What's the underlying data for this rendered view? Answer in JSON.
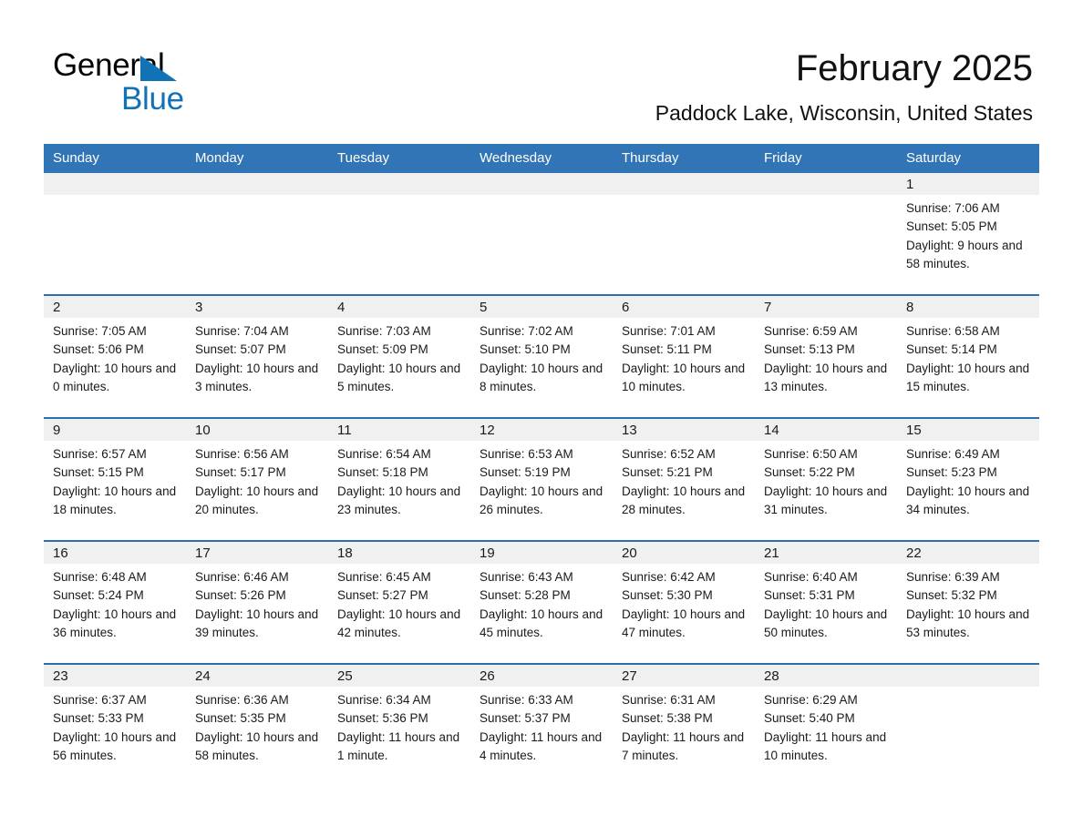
{
  "brand": {
    "name_part1": "General",
    "name_part2": "Blue",
    "triangle_color": "#1272b8"
  },
  "header": {
    "title": "February 2025",
    "subtitle": "Paddock Lake, Wisconsin, United States"
  },
  "colors": {
    "header_blue": "#3275b6",
    "row_rule_blue": "#2f6fae",
    "daynum_band": "#f0f0f0",
    "text": "#1a1a1a"
  },
  "weekday_headers": [
    "Sunday",
    "Monday",
    "Tuesday",
    "Wednesday",
    "Thursday",
    "Friday",
    "Saturday"
  ],
  "labels": {
    "sunrise_prefix": "Sunrise:",
    "sunset_prefix": "Sunset:",
    "daylight_prefix": "Daylight:"
  },
  "weeks": [
    [
      {
        "day": "",
        "sunrise": "",
        "sunset": "",
        "daylight": ""
      },
      {
        "day": "",
        "sunrise": "",
        "sunset": "",
        "daylight": ""
      },
      {
        "day": "",
        "sunrise": "",
        "sunset": "",
        "daylight": ""
      },
      {
        "day": "",
        "sunrise": "",
        "sunset": "",
        "daylight": ""
      },
      {
        "day": "",
        "sunrise": "",
        "sunset": "",
        "daylight": ""
      },
      {
        "day": "",
        "sunrise": "",
        "sunset": "",
        "daylight": ""
      },
      {
        "day": "1",
        "sunrise": "Sunrise: 7:06 AM",
        "sunset": "Sunset: 5:05 PM",
        "daylight": "Daylight: 9 hours and 58 minutes."
      }
    ],
    [
      {
        "day": "2",
        "sunrise": "Sunrise: 7:05 AM",
        "sunset": "Sunset: 5:06 PM",
        "daylight": "Daylight: 10 hours and 0 minutes."
      },
      {
        "day": "3",
        "sunrise": "Sunrise: 7:04 AM",
        "sunset": "Sunset: 5:07 PM",
        "daylight": "Daylight: 10 hours and 3 minutes."
      },
      {
        "day": "4",
        "sunrise": "Sunrise: 7:03 AM",
        "sunset": "Sunset: 5:09 PM",
        "daylight": "Daylight: 10 hours and 5 minutes."
      },
      {
        "day": "5",
        "sunrise": "Sunrise: 7:02 AM",
        "sunset": "Sunset: 5:10 PM",
        "daylight": "Daylight: 10 hours and 8 minutes."
      },
      {
        "day": "6",
        "sunrise": "Sunrise: 7:01 AM",
        "sunset": "Sunset: 5:11 PM",
        "daylight": "Daylight: 10 hours and 10 minutes."
      },
      {
        "day": "7",
        "sunrise": "Sunrise: 6:59 AM",
        "sunset": "Sunset: 5:13 PM",
        "daylight": "Daylight: 10 hours and 13 minutes."
      },
      {
        "day": "8",
        "sunrise": "Sunrise: 6:58 AM",
        "sunset": "Sunset: 5:14 PM",
        "daylight": "Daylight: 10 hours and 15 minutes."
      }
    ],
    [
      {
        "day": "9",
        "sunrise": "Sunrise: 6:57 AM",
        "sunset": "Sunset: 5:15 PM",
        "daylight": "Daylight: 10 hours and 18 minutes."
      },
      {
        "day": "10",
        "sunrise": "Sunrise: 6:56 AM",
        "sunset": "Sunset: 5:17 PM",
        "daylight": "Daylight: 10 hours and 20 minutes."
      },
      {
        "day": "11",
        "sunrise": "Sunrise: 6:54 AM",
        "sunset": "Sunset: 5:18 PM",
        "daylight": "Daylight: 10 hours and 23 minutes."
      },
      {
        "day": "12",
        "sunrise": "Sunrise: 6:53 AM",
        "sunset": "Sunset: 5:19 PM",
        "daylight": "Daylight: 10 hours and 26 minutes."
      },
      {
        "day": "13",
        "sunrise": "Sunrise: 6:52 AM",
        "sunset": "Sunset: 5:21 PM",
        "daylight": "Daylight: 10 hours and 28 minutes."
      },
      {
        "day": "14",
        "sunrise": "Sunrise: 6:50 AM",
        "sunset": "Sunset: 5:22 PM",
        "daylight": "Daylight: 10 hours and 31 minutes."
      },
      {
        "day": "15",
        "sunrise": "Sunrise: 6:49 AM",
        "sunset": "Sunset: 5:23 PM",
        "daylight": "Daylight: 10 hours and 34 minutes."
      }
    ],
    [
      {
        "day": "16",
        "sunrise": "Sunrise: 6:48 AM",
        "sunset": "Sunset: 5:24 PM",
        "daylight": "Daylight: 10 hours and 36 minutes."
      },
      {
        "day": "17",
        "sunrise": "Sunrise: 6:46 AM",
        "sunset": "Sunset: 5:26 PM",
        "daylight": "Daylight: 10 hours and 39 minutes."
      },
      {
        "day": "18",
        "sunrise": "Sunrise: 6:45 AM",
        "sunset": "Sunset: 5:27 PM",
        "daylight": "Daylight: 10 hours and 42 minutes."
      },
      {
        "day": "19",
        "sunrise": "Sunrise: 6:43 AM",
        "sunset": "Sunset: 5:28 PM",
        "daylight": "Daylight: 10 hours and 45 minutes."
      },
      {
        "day": "20",
        "sunrise": "Sunrise: 6:42 AM",
        "sunset": "Sunset: 5:30 PM",
        "daylight": "Daylight: 10 hours and 47 minutes."
      },
      {
        "day": "21",
        "sunrise": "Sunrise: 6:40 AM",
        "sunset": "Sunset: 5:31 PM",
        "daylight": "Daylight: 10 hours and 50 minutes."
      },
      {
        "day": "22",
        "sunrise": "Sunrise: 6:39 AM",
        "sunset": "Sunset: 5:32 PM",
        "daylight": "Daylight: 10 hours and 53 minutes."
      }
    ],
    [
      {
        "day": "23",
        "sunrise": "Sunrise: 6:37 AM",
        "sunset": "Sunset: 5:33 PM",
        "daylight": "Daylight: 10 hours and 56 minutes."
      },
      {
        "day": "24",
        "sunrise": "Sunrise: 6:36 AM",
        "sunset": "Sunset: 5:35 PM",
        "daylight": "Daylight: 10 hours and 58 minutes."
      },
      {
        "day": "25",
        "sunrise": "Sunrise: 6:34 AM",
        "sunset": "Sunset: 5:36 PM",
        "daylight": "Daylight: 11 hours and 1 minute."
      },
      {
        "day": "26",
        "sunrise": "Sunrise: 6:33 AM",
        "sunset": "Sunset: 5:37 PM",
        "daylight": "Daylight: 11 hours and 4 minutes."
      },
      {
        "day": "27",
        "sunrise": "Sunrise: 6:31 AM",
        "sunset": "Sunset: 5:38 PM",
        "daylight": "Daylight: 11 hours and 7 minutes."
      },
      {
        "day": "28",
        "sunrise": "Sunrise: 6:29 AM",
        "sunset": "Sunset: 5:40 PM",
        "daylight": "Daylight: 11 hours and 10 minutes."
      },
      {
        "day": "",
        "sunrise": "",
        "sunset": "",
        "daylight": ""
      }
    ]
  ]
}
